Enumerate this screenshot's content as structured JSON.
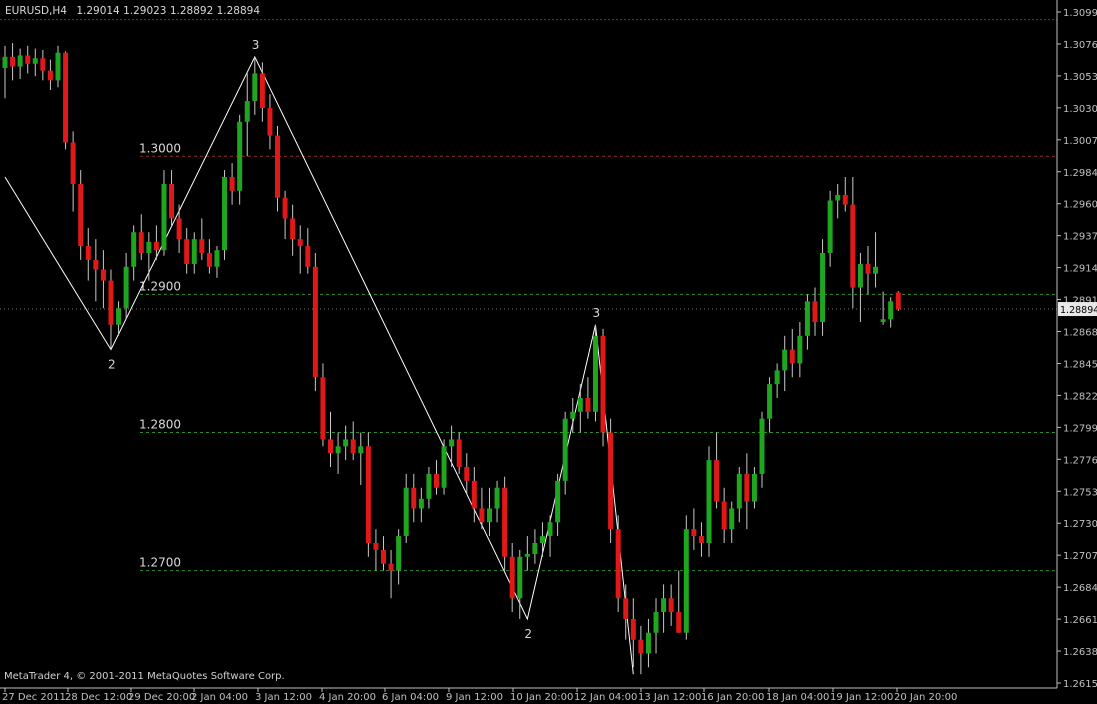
{
  "header": {
    "symbol": "EURUSD,H4",
    "ohlc": "1.29014 1.29023 1.28892 1.28894"
  },
  "footer": {
    "copyright": "MetaTrader 4, © 2001-2011 MetaQuotes Software Corp."
  },
  "colors": {
    "background": "#000000",
    "bull": "#1fa51f",
    "bear": "#e01818",
    "wick": "#c8c8c8",
    "axis": "#c0c0c0",
    "level": "#2e8f2e",
    "resistance": "#9a2b2b",
    "zigzag": "#ffffff",
    "label": "#d8d8d8"
  },
  "chart_data": {
    "type": "candlestick",
    "symbol": "EURUSD",
    "timeframe": "H4",
    "price_range": [
      1.2615,
      1.3111
    ],
    "price_ticks": [
      "1.30990",
      "1.30760",
      "1.30535",
      "1.30300",
      "1.30070",
      "1.29840",
      "1.29605",
      "1.29375",
      "1.29145",
      "1.28915",
      "1.28685",
      "1.28455",
      "1.28225",
      "1.27995",
      "1.27765",
      "1.27535",
      "1.27300",
      "1.27070",
      "1.26840",
      "1.26610",
      "1.26380",
      "1.26150"
    ],
    "current_price": "1.28894",
    "time_labels": [
      "27 Dec 2011",
      "28 Dec 12:00",
      "29 Dec 20:00",
      "2 Jan 04:00",
      "3 Jan 12:00",
      "4 Jan 20:00",
      "6 Jan 04:00",
      "9 Jan 12:00",
      "10 Jan 20:00",
      "12 Jan 04:00",
      "13 Jan 12:00",
      "16 Jan 20:00",
      "18 Jan 04:00",
      "19 Jan 12:00",
      "20 Jan 20:00"
    ],
    "levels": [
      {
        "label": "1.3000",
        "value": 1.3,
        "color": "green"
      },
      {
        "label": "1.2900",
        "value": 1.29,
        "color": "green"
      },
      {
        "label": "1.2800",
        "value": 1.28,
        "color": "green"
      },
      {
        "label": "1.2700",
        "value": 1.27,
        "color": "green"
      }
    ],
    "top_line": 1.3099,
    "zigzag": [
      {
        "i": 0,
        "price": 1.2985,
        "label": ""
      },
      {
        "i": 14,
        "price": 1.286,
        "label": "2"
      },
      {
        "i": 33,
        "price": 1.3072,
        "label": "3"
      },
      {
        "i": 69,
        "price": 1.2665,
        "label": "2"
      },
      {
        "i": 78,
        "price": 1.2878,
        "label": "3"
      },
      {
        "i": 83,
        "price": 1.2625,
        "label": ""
      }
    ],
    "candles": [
      [
        1.3064,
        1.308,
        1.3042,
        1.3072
      ],
      [
        1.3072,
        1.3082,
        1.3055,
        1.3065
      ],
      [
        1.3065,
        1.3078,
        1.3056,
        1.3073
      ],
      [
        1.3073,
        1.308,
        1.306,
        1.3067
      ],
      [
        1.3067,
        1.3078,
        1.3058,
        1.3071
      ],
      [
        1.3071,
        1.3077,
        1.3055,
        1.3062
      ],
      [
        1.3062,
        1.307,
        1.3048,
        1.3055
      ],
      [
        1.3055,
        1.308,
        1.305,
        1.3075
      ],
      [
        1.3075,
        1.3076,
        1.3005,
        1.301
      ],
      [
        1.301,
        1.3018,
        1.296,
        1.298
      ],
      [
        1.298,
        1.299,
        1.2925,
        1.2935
      ],
      [
        1.2935,
        1.2948,
        1.291,
        1.2925
      ],
      [
        1.2925,
        1.294,
        1.2895,
        1.2918
      ],
      [
        1.2918,
        1.2932,
        1.289,
        1.291
      ],
      [
        1.291,
        1.2918,
        1.286,
        1.2878
      ],
      [
        1.2878,
        1.2895,
        1.287,
        1.289
      ],
      [
        1.289,
        1.293,
        1.2882,
        1.292
      ],
      [
        1.292,
        1.295,
        1.291,
        1.2945
      ],
      [
        1.2945,
        1.2958,
        1.2925,
        1.293
      ],
      [
        1.293,
        1.2945,
        1.291,
        1.2938
      ],
      [
        1.2938,
        1.295,
        1.2925,
        1.2932
      ],
      [
        1.2932,
        1.299,
        1.2928,
        1.298
      ],
      [
        1.298,
        1.299,
        1.295,
        1.2955
      ],
      [
        1.2955,
        1.2965,
        1.293,
        1.294
      ],
      [
        1.294,
        1.2948,
        1.2915,
        1.2922
      ],
      [
        1.2922,
        1.2945,
        1.2915,
        1.294
      ],
      [
        1.294,
        1.2955,
        1.2925,
        1.293
      ],
      [
        1.293,
        1.294,
        1.2915,
        1.292
      ],
      [
        1.292,
        1.2935,
        1.2912,
        1.2932
      ],
      [
        1.2932,
        1.299,
        1.2925,
        1.2985
      ],
      [
        1.2985,
        1.2995,
        1.2965,
        1.2975
      ],
      [
        1.2975,
        1.303,
        1.2965,
        1.3025
      ],
      [
        1.3025,
        1.306,
        1.3,
        1.304
      ],
      [
        1.304,
        1.3072,
        1.303,
        1.306
      ],
      [
        1.306,
        1.3068,
        1.3025,
        1.3035
      ],
      [
        1.3035,
        1.3045,
        1.3005,
        1.3015
      ],
      [
        1.3015,
        1.3022,
        1.296,
        1.297
      ],
      [
        1.297,
        1.2975,
        1.294,
        1.2955
      ],
      [
        1.2955,
        1.2965,
        1.2928,
        1.294
      ],
      [
        1.294,
        1.295,
        1.2915,
        1.2935
      ],
      [
        1.2935,
        1.2948,
        1.2915,
        1.292
      ],
      [
        1.292,
        1.293,
        1.283,
        1.284
      ],
      [
        1.284,
        1.285,
        1.279,
        1.2795
      ],
      [
        1.2795,
        1.2815,
        1.2775,
        1.2785
      ],
      [
        1.2785,
        1.28,
        1.277,
        1.279
      ],
      [
        1.279,
        1.2805,
        1.278,
        1.2795
      ],
      [
        1.2795,
        1.2808,
        1.278,
        1.2785
      ],
      [
        1.2785,
        1.28,
        1.2762,
        1.279
      ],
      [
        1.279,
        1.28,
        1.271,
        1.272
      ],
      [
        1.272,
        1.273,
        1.27,
        1.2715
      ],
      [
        1.2715,
        1.2725,
        1.27,
        1.2705
      ],
      [
        1.2705,
        1.2715,
        1.268,
        1.27
      ],
      [
        1.27,
        1.273,
        1.269,
        1.2725
      ],
      [
        1.2725,
        1.277,
        1.272,
        1.276
      ],
      [
        1.276,
        1.277,
        1.2735,
        1.2745
      ],
      [
        1.2745,
        1.276,
        1.2735,
        1.2752
      ],
      [
        1.2752,
        1.2775,
        1.2745,
        1.277
      ],
      [
        1.277,
        1.278,
        1.2755,
        1.276
      ],
      [
        1.276,
        1.2795,
        1.2755,
        1.279
      ],
      [
        1.279,
        1.2805,
        1.2775,
        1.2795
      ],
      [
        1.2795,
        1.28,
        1.277,
        1.2775
      ],
      [
        1.2775,
        1.2785,
        1.2755,
        1.2765
      ],
      [
        1.2765,
        1.2775,
        1.2735,
        1.2745
      ],
      [
        1.2745,
        1.276,
        1.273,
        1.2735
      ],
      [
        1.2735,
        1.276,
        1.2725,
        1.2745
      ],
      [
        1.2745,
        1.2765,
        1.2735,
        1.276
      ],
      [
        1.276,
        1.2768,
        1.27,
        1.271
      ],
      [
        1.271,
        1.272,
        1.267,
        1.268
      ],
      [
        1.268,
        1.2715,
        1.2665,
        1.271
      ],
      [
        1.271,
        1.2725,
        1.27,
        1.2712
      ],
      [
        1.2712,
        1.273,
        1.2705,
        1.272
      ],
      [
        1.272,
        1.2735,
        1.271,
        1.2725
      ],
      [
        1.2725,
        1.274,
        1.271,
        1.2735
      ],
      [
        1.2735,
        1.277,
        1.2725,
        1.2765
      ],
      [
        1.2765,
        1.2815,
        1.2755,
        1.281
      ],
      [
        1.281,
        1.2825,
        1.28,
        1.2815
      ],
      [
        1.2815,
        1.2835,
        1.28,
        1.2825
      ],
      [
        1.2825,
        1.284,
        1.281,
        1.2815
      ],
      [
        1.2815,
        1.2878,
        1.2808,
        1.287
      ],
      [
        1.287,
        1.2875,
        1.279,
        1.28
      ],
      [
        1.28,
        1.281,
        1.272,
        1.273
      ],
      [
        1.273,
        1.274,
        1.267,
        1.268
      ],
      [
        1.268,
        1.269,
        1.265,
        1.2665
      ],
      [
        1.2665,
        1.268,
        1.263,
        1.265
      ],
      [
        1.265,
        1.266,
        1.2625,
        1.264
      ],
      [
        1.264,
        1.2665,
        1.263,
        1.2655
      ],
      [
        1.2655,
        1.268,
        1.264,
        1.267
      ],
      [
        1.267,
        1.269,
        1.2655,
        1.268
      ],
      [
        1.268,
        1.269,
        1.266,
        1.267
      ],
      [
        1.267,
        1.27,
        1.2655,
        1.2655
      ],
      [
        1.2655,
        1.274,
        1.265,
        1.273
      ],
      [
        1.273,
        1.2745,
        1.2715,
        1.2725
      ],
      [
        1.2725,
        1.2735,
        1.271,
        1.272
      ],
      [
        1.272,
        1.279,
        1.271,
        1.278
      ],
      [
        1.278,
        1.28,
        1.2745,
        1.275
      ],
      [
        1.275,
        1.276,
        1.272,
        1.273
      ],
      [
        1.273,
        1.275,
        1.272,
        1.2745
      ],
      [
        1.2745,
        1.2775,
        1.2735,
        1.277
      ],
      [
        1.277,
        1.2785,
        1.273,
        1.275
      ],
      [
        1.275,
        1.2775,
        1.2745,
        1.277
      ],
      [
        1.277,
        1.2815,
        1.276,
        1.281
      ],
      [
        1.281,
        1.284,
        1.28,
        1.2835
      ],
      [
        1.2835,
        1.285,
        1.2825,
        1.2845
      ],
      [
        1.2845,
        1.287,
        1.283,
        1.286
      ],
      [
        1.286,
        1.2875,
        1.284,
        1.285
      ],
      [
        1.285,
        1.288,
        1.284,
        1.287
      ],
      [
        1.287,
        1.29,
        1.286,
        1.2895
      ],
      [
        1.2895,
        1.2905,
        1.287,
        1.288
      ],
      [
        1.288,
        1.294,
        1.287,
        1.293
      ],
      [
        1.293,
        1.2975,
        1.292,
        1.2968
      ],
      [
        1.2968,
        1.298,
        1.2955,
        1.2972
      ],
      [
        1.2972,
        1.2985,
        1.296,
        1.2965
      ],
      [
        1.2965,
        1.2985,
        1.289,
        1.2905
      ],
      [
        1.2905,
        1.293,
        1.288,
        1.2922
      ],
      [
        1.2922,
        1.2935,
        1.29,
        1.2915
      ],
      [
        1.2915,
        1.2945,
        1.2905,
        1.292
      ],
      [
        1.288,
        1.2902,
        1.2878,
        1.2882
      ],
      [
        1.2882,
        1.2898,
        1.2876,
        1.2895
      ],
      [
        1.29014,
        1.29023,
        1.2888,
        1.28894
      ]
    ]
  }
}
